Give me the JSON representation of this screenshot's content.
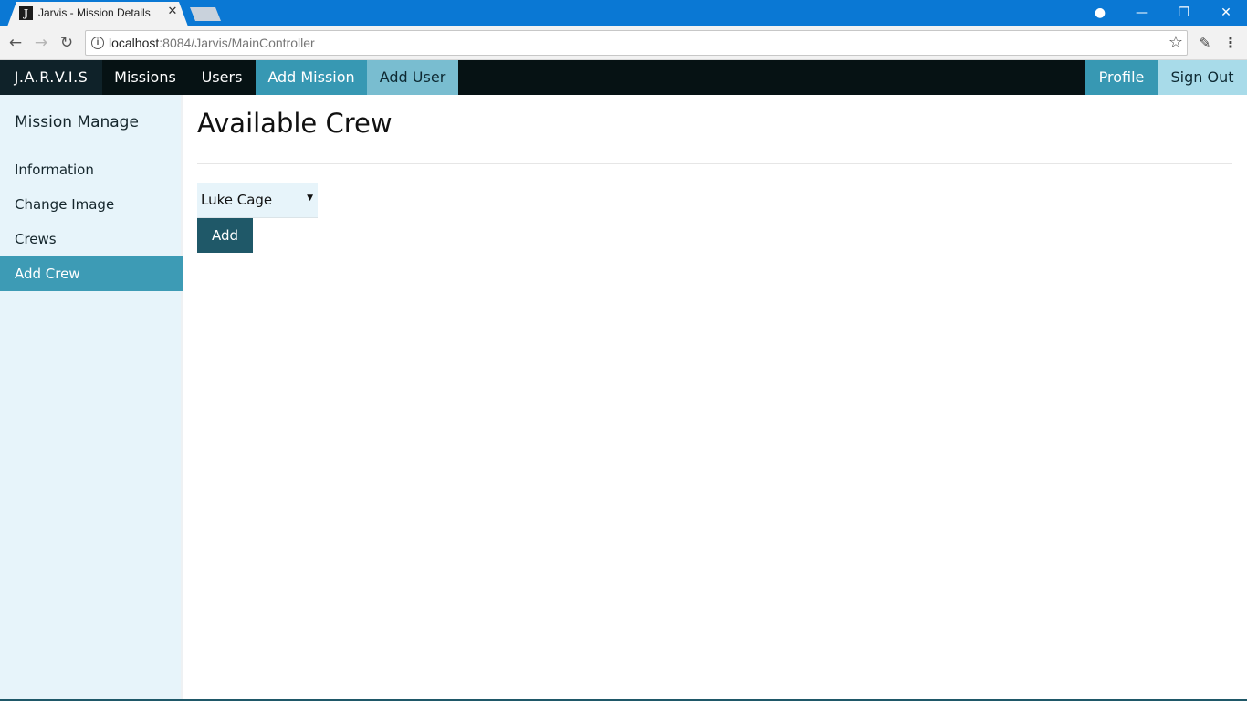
{
  "browser": {
    "tab_title": "Jarvis - Mission Details",
    "tab_favicon": "J",
    "tab_close_glyph": "✕",
    "url_host": "localhost",
    "url_rest": ":8084/Jarvis/MainController",
    "icons": {
      "back": "←",
      "forward": "→",
      "reload": "↻",
      "info": "i",
      "star": "☆",
      "eyedropper": "✎",
      "menu": "⋮",
      "profile": "●",
      "minimize": "—",
      "maximize": "❐",
      "close": "✕"
    }
  },
  "navbar": {
    "brand": "J.A.R.V.I.S",
    "items": [
      "Missions",
      "Users",
      "Add Mission",
      "Add User"
    ],
    "right": [
      "Profile",
      "Sign Out"
    ]
  },
  "sidebar": {
    "heading": "Mission Manage",
    "items": [
      "Information",
      "Change Image",
      "Crews",
      "Add Crew"
    ],
    "active": "Add Crew"
  },
  "main": {
    "title": "Available Crew",
    "select_value": "Luke Cage",
    "add_label": "Add"
  },
  "colors": {
    "titlebar": "#0a78d4",
    "navbar_bg": "#061214",
    "accent": "#3798b3",
    "sidebar_bg": "#e7f4fa",
    "button_dark": "#1f5868"
  }
}
